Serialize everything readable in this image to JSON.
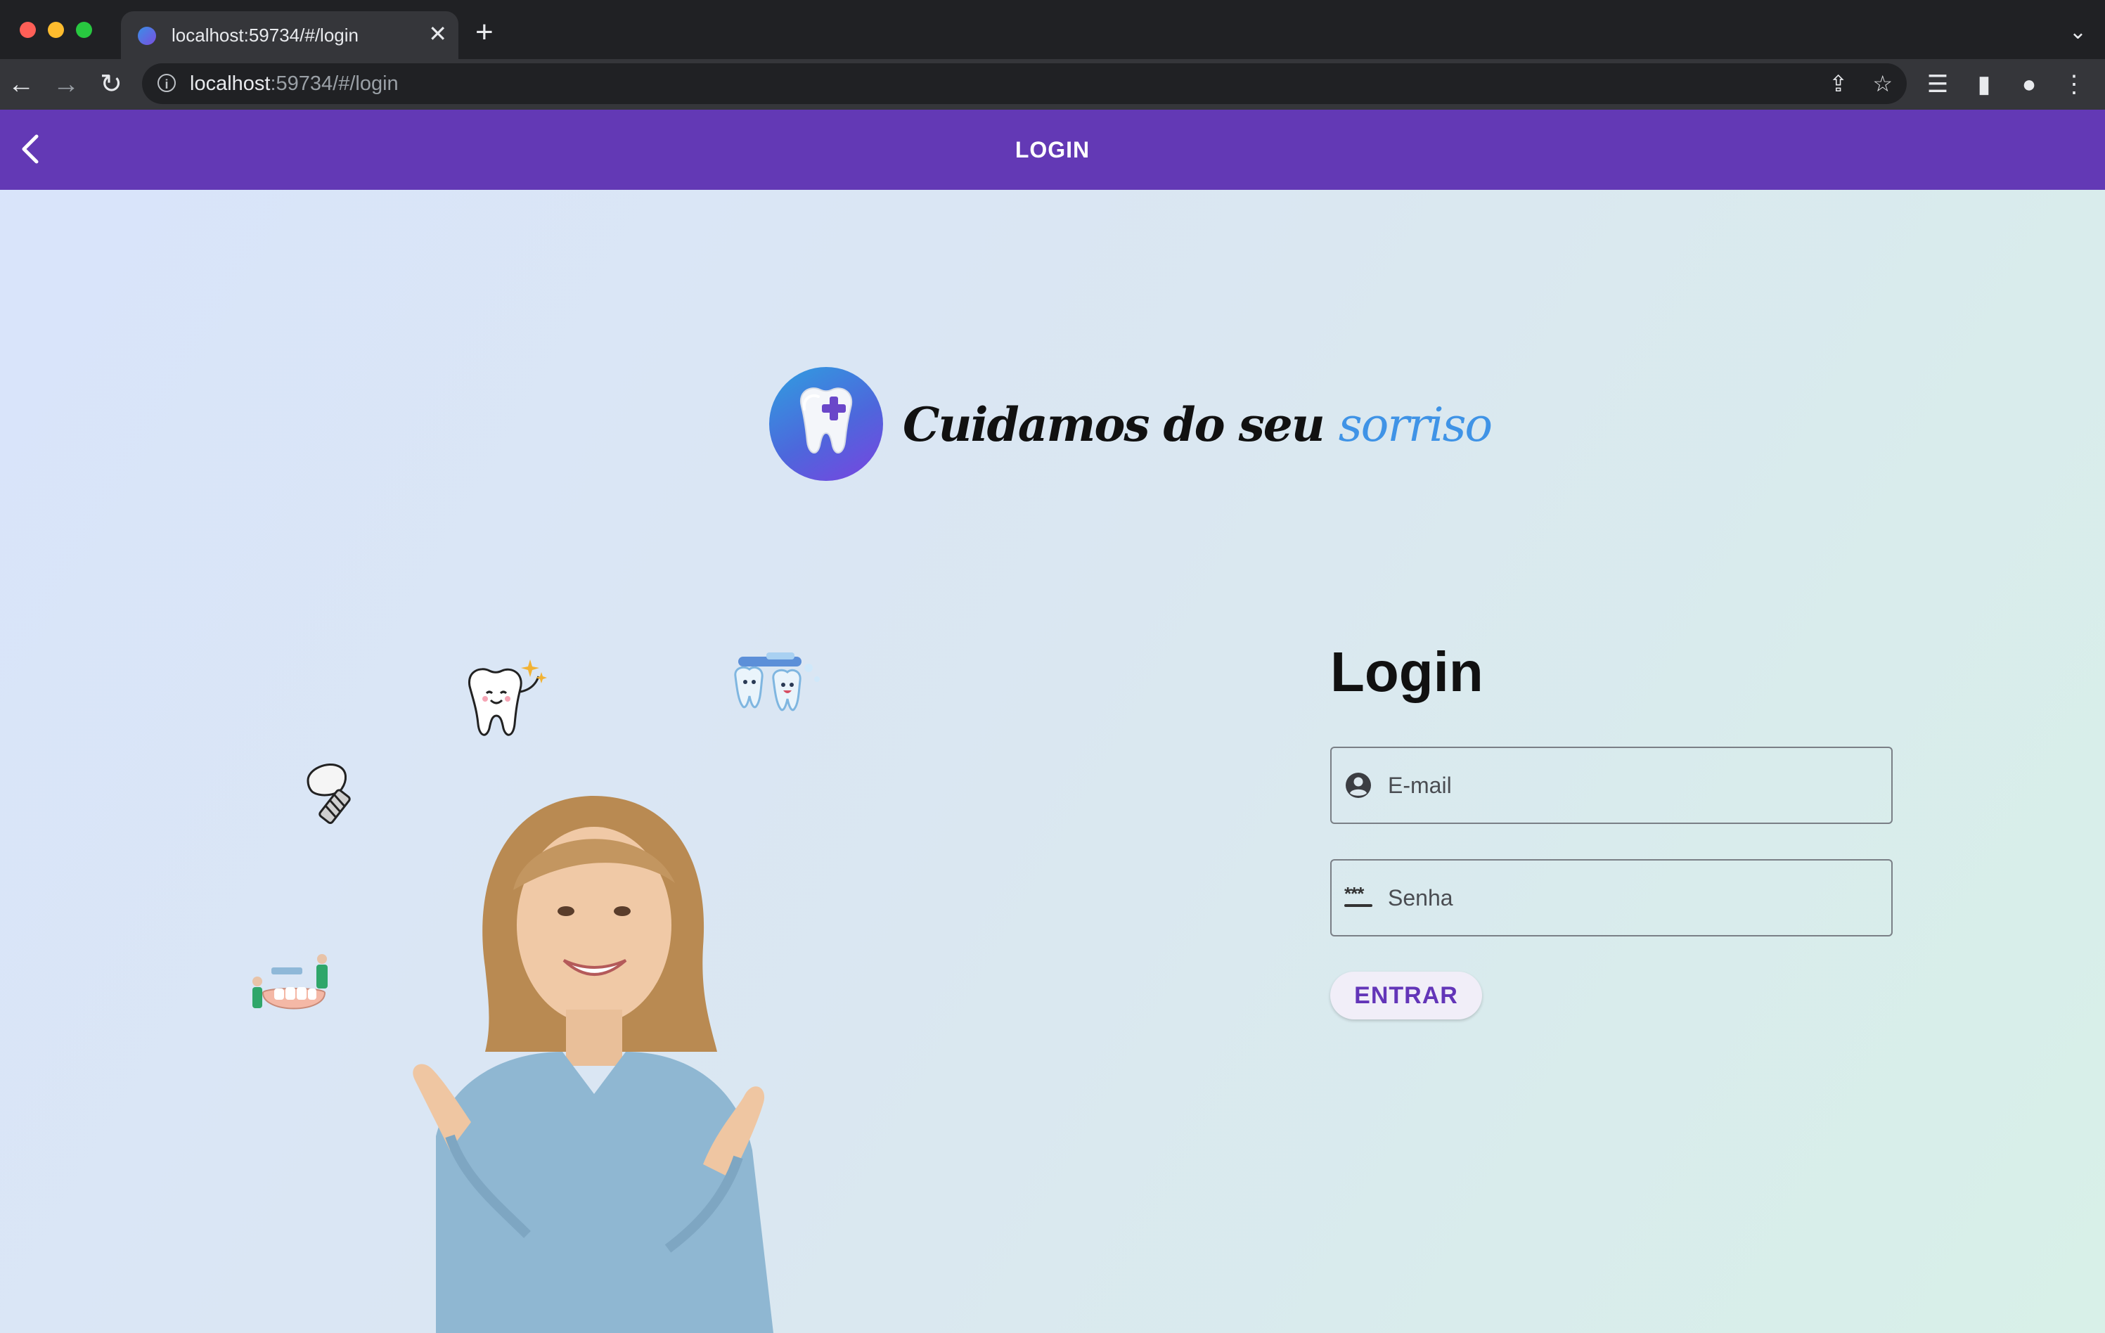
{
  "browser": {
    "tab_title": "localhost:59734/#/login",
    "url_host": "localhost",
    "url_rest": ":59734/#/login",
    "traffic_colors": [
      "#ff5f57",
      "#febc2e",
      "#28c840"
    ]
  },
  "appbar": {
    "title": "LOGIN",
    "color": "#6339b5"
  },
  "hero": {
    "text_main": "Cuidamos do seu ",
    "text_accent": "sorriso"
  },
  "login": {
    "title": "Login",
    "email_placeholder": "E-mail",
    "password_placeholder": "Senha",
    "submit_label": "ENTRAR"
  },
  "icons": [
    "back-arrow-icon",
    "account-circle-icon",
    "password-icon",
    "tooth-logo-icon"
  ]
}
